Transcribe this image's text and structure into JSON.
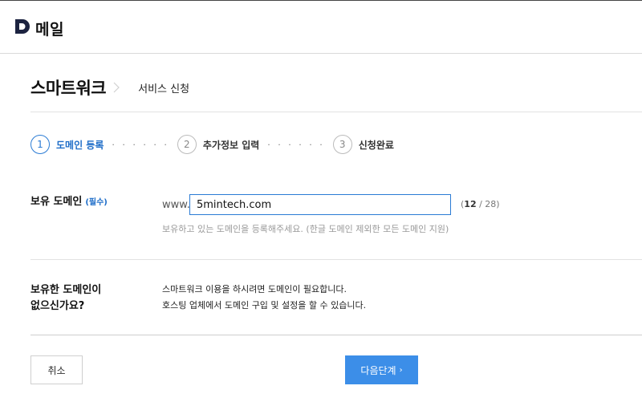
{
  "header": {
    "app_name": "메일",
    "logo_icon": "d-logo-icon",
    "brand_color": "#1c2340"
  },
  "breadcrumb": {
    "main": "스마트워크",
    "sub": "서비스 신청"
  },
  "steps": [
    {
      "number": "1",
      "label": "도메인 등록",
      "active": true
    },
    {
      "number": "2",
      "label": "추가정보 입력",
      "active": false
    },
    {
      "number": "3",
      "label": "신청완료",
      "active": false
    }
  ],
  "step_separator": "· · · · · ·",
  "domain_field": {
    "label": "보유 도메인",
    "required_tag": "(필수)",
    "prefix": "www.",
    "value": "5mintech.com",
    "counter_current": "12",
    "counter_max": " / 28)",
    "counter_open": "(",
    "help": "보유하고 있는 도메인을 등록해주세요. (한글 도메인 제외한 모든 도메인 지원)"
  },
  "no_domain": {
    "label_line1": "보유한 도메인이",
    "label_line2": "없으신가요?",
    "info_line1": "스마트워크 이용을 하시려면 도메인이 필요합니다.",
    "info_line2": "호스팅 업체에서 도메인 구입 및 설정을 할 수 있습니다."
  },
  "buttons": {
    "cancel": "취소",
    "next": "다음단계",
    "next_arrow": "›"
  },
  "colors": {
    "accent": "#3c8ee8",
    "active_step": "#1e6dc8"
  }
}
